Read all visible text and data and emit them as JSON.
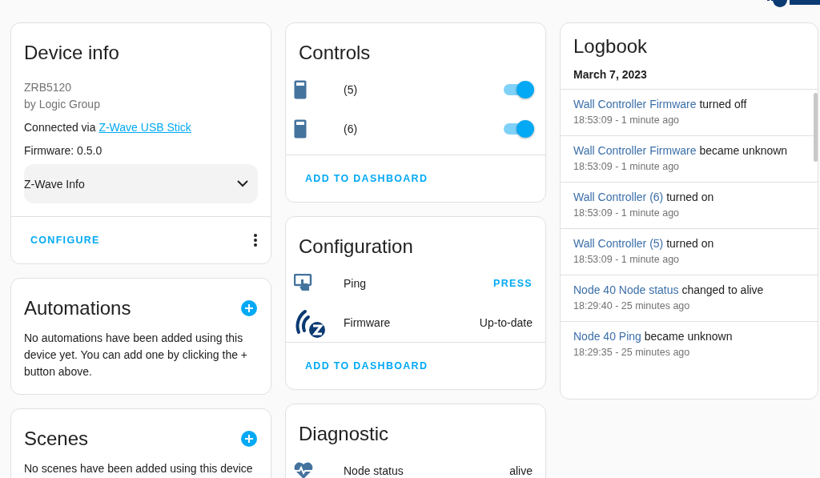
{
  "device_info": {
    "title": "Device info",
    "model": "ZRB5120",
    "manufacturer": "by Logic Group",
    "connected_prefix": "Connected via",
    "connected_link": "Z-Wave USB Stick",
    "firmware": "Firmware: 0.5.0",
    "expander": {
      "label": "Z-Wave Info",
      "expanded": false
    },
    "action": "CONFIGURE"
  },
  "automations": {
    "title": "Automations",
    "text": "No automations have been added using this device yet. You can add one by clicking the + button above."
  },
  "scenes": {
    "title": "Scenes",
    "text": "No scenes have been added using this device"
  },
  "controls": {
    "title": "Controls",
    "items": [
      {
        "name": "(5)",
        "on": true
      },
      {
        "name": "(6)",
        "on": true
      }
    ],
    "action": "ADD TO DASHBOARD"
  },
  "configuration": {
    "title": "Configuration",
    "items": [
      {
        "kind": "button",
        "name": "Ping",
        "action": "PRESS"
      },
      {
        "kind": "value",
        "name": "Firmware",
        "value": "Up-to-date"
      }
    ],
    "action": "ADD TO DASHBOARD"
  },
  "diagnostic": {
    "title": "Diagnostic",
    "items": [
      {
        "name": "Node status",
        "value": "alive"
      }
    ]
  },
  "logbook": {
    "title": "Logbook",
    "date": "March 7, 2023",
    "entries": [
      {
        "entity": "Wall Controller Firmware",
        "message": "turned off",
        "time": "18:53:09 - 1 minute ago"
      },
      {
        "entity": "Wall Controller Firmware",
        "message": "became unknown",
        "time": "18:53:09 - 1 minute ago"
      },
      {
        "entity": "Wall Controller (6)",
        "message": "turned on",
        "time": "18:53:09 - 1 minute ago"
      },
      {
        "entity": "Wall Controller (5)",
        "message": "turned on",
        "time": "18:53:09 - 1 minute ago"
      },
      {
        "entity": "Node 40 Node status",
        "message": "changed to alive",
        "time": "18:29:40 - 25 minutes ago"
      },
      {
        "entity": "Node 40 Ping",
        "message": "became unknown",
        "time": "18:29:35 - 25 minutes ago"
      }
    ]
  }
}
